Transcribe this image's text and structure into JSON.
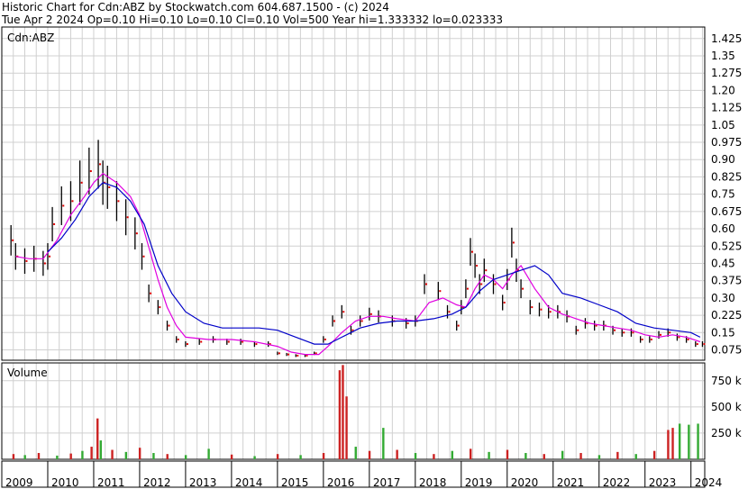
{
  "header": {
    "title_line": "Historic Chart for Cdn:ABZ by Stockwatch.com 604.687.1500 - (c) 2024",
    "stats_line": "Tue Apr  2 2024  Op=0.10  Hi=0.10  Lo=0.10  Cl=0.10  Vol=500  Year hi=1.333332  lo=0.023333"
  },
  "colors": {
    "bar": "#000000",
    "ma_short": "#e000e0",
    "ma_long": "#0000c8",
    "volume_up": "#33aa33",
    "volume_down": "#cc2222",
    "grid": "#d0d0d0",
    "points": "#dd0000"
  },
  "chart_data": [
    {
      "type": "line",
      "panel_label": "Cdn:ABZ",
      "x_ticks": [
        "2009",
        "2010",
        "2011",
        "2012",
        "2013",
        "2014",
        "2015",
        "2016",
        "2017",
        "2018",
        "2019",
        "2020",
        "2021",
        "2022",
        "2023",
        "2024"
      ],
      "y_ticks": [
        "1.425",
        "1.35",
        "1.275",
        "1.20",
        "1.125",
        "1.05",
        "0.975",
        "0.90",
        "0.825",
        "0.75",
        "0.675",
        "0.60",
        "0.525",
        "0.45",
        "0.375",
        "0.30",
        "0.225",
        "0.15",
        "0.075"
      ],
      "ylim": [
        0.03,
        1.475
      ],
      "x_range": [
        2009.0,
        2024.3
      ],
      "series": [
        {
          "key": "price",
          "x": [
            2009.2,
            2009.3,
            2009.5,
            2009.7,
            2009.9,
            2010.0,
            2010.1,
            2010.3,
            2010.5,
            2010.7,
            2010.9,
            2011.1,
            2011.2,
            2011.3,
            2011.5,
            2011.7,
            2011.9,
            2012.05,
            2012.2,
            2012.4,
            2012.6,
            2012.8,
            2013.0,
            2013.3,
            2013.6,
            2013.9,
            2014.2,
            2014.5,
            2014.8,
            2015.0,
            2015.2,
            2015.4,
            2015.6,
            2015.8,
            2016.0,
            2016.2,
            2016.4,
            2016.6,
            2016.8,
            2017.0,
            2017.2,
            2017.5,
            2017.8,
            2018.0,
            2018.2,
            2018.5,
            2018.7,
            2018.9,
            2019.0,
            2019.1,
            2019.2,
            2019.3,
            2019.4,
            2019.5,
            2019.7,
            2019.9,
            2020.0,
            2020.1,
            2020.2,
            2020.3,
            2020.5,
            2020.7,
            2020.9,
            2021.1,
            2021.3,
            2021.5,
            2021.7,
            2021.9,
            2022.1,
            2022.3,
            2022.5,
            2022.7,
            2022.9,
            2023.1,
            2023.3,
            2023.5,
            2023.7,
            2023.9,
            2024.1,
            2024.25
          ],
          "values": [
            0.55,
            0.48,
            0.46,
            0.47,
            0.45,
            0.48,
            0.62,
            0.7,
            0.72,
            0.8,
            0.85,
            0.88,
            0.8,
            0.78,
            0.72,
            0.65,
            0.58,
            0.48,
            0.32,
            0.26,
            0.18,
            0.12,
            0.1,
            0.11,
            0.12,
            0.11,
            0.11,
            0.1,
            0.1,
            0.06,
            0.055,
            0.05,
            0.05,
            0.06,
            0.12,
            0.2,
            0.24,
            0.16,
            0.2,
            0.23,
            0.22,
            0.2,
            0.19,
            0.2,
            0.36,
            0.33,
            0.24,
            0.18,
            0.26,
            0.34,
            0.5,
            0.44,
            0.36,
            0.42,
            0.36,
            0.28,
            0.38,
            0.54,
            0.42,
            0.34,
            0.26,
            0.25,
            0.24,
            0.24,
            0.22,
            0.16,
            0.19,
            0.18,
            0.18,
            0.16,
            0.15,
            0.15,
            0.12,
            0.12,
            0.14,
            0.15,
            0.13,
            0.12,
            0.1,
            0.1
          ]
        },
        {
          "key": "ma_short",
          "x": [
            2009.3,
            2009.6,
            2009.9,
            2010.2,
            2010.5,
            2010.8,
            2011.0,
            2011.2,
            2011.5,
            2011.8,
            2012.0,
            2012.2,
            2012.4,
            2012.6,
            2012.8,
            2013.0,
            2013.5,
            2014.0,
            2014.5,
            2015.0,
            2015.3,
            2015.6,
            2015.9,
            2016.1,
            2016.4,
            2016.7,
            2017.0,
            2017.3,
            2017.6,
            2018.0,
            2018.3,
            2018.6,
            2018.9,
            2019.1,
            2019.3,
            2019.5,
            2019.7,
            2019.9,
            2020.1,
            2020.3,
            2020.6,
            2020.9,
            2021.2,
            2021.5,
            2021.8,
            2022.1,
            2022.4,
            2022.7,
            2023.0,
            2023.3,
            2023.6,
            2023.9,
            2024.2
          ],
          "values": [
            0.48,
            0.47,
            0.47,
            0.55,
            0.66,
            0.74,
            0.8,
            0.84,
            0.8,
            0.74,
            0.66,
            0.52,
            0.38,
            0.26,
            0.18,
            0.13,
            0.12,
            0.12,
            0.11,
            0.09,
            0.065,
            0.055,
            0.055,
            0.09,
            0.15,
            0.2,
            0.22,
            0.22,
            0.21,
            0.2,
            0.28,
            0.3,
            0.27,
            0.26,
            0.34,
            0.4,
            0.38,
            0.34,
            0.4,
            0.44,
            0.34,
            0.26,
            0.23,
            0.21,
            0.19,
            0.18,
            0.17,
            0.16,
            0.14,
            0.13,
            0.14,
            0.13,
            0.11
          ]
        },
        {
          "key": "ma_long",
          "x": [
            2010.0,
            2010.3,
            2010.6,
            2010.9,
            2011.2,
            2011.5,
            2011.8,
            2012.1,
            2012.4,
            2012.7,
            2013.0,
            2013.4,
            2013.8,
            2014.2,
            2014.6,
            2015.0,
            2015.4,
            2015.8,
            2016.1,
            2016.4,
            2016.8,
            2017.2,
            2017.6,
            2018.0,
            2018.4,
            2018.8,
            2019.1,
            2019.4,
            2019.7,
            2020.0,
            2020.3,
            2020.6,
            2020.9,
            2021.2,
            2021.6,
            2022.0,
            2022.4,
            2022.8,
            2023.2,
            2023.6,
            2024.0,
            2024.2
          ],
          "values": [
            0.5,
            0.56,
            0.64,
            0.74,
            0.8,
            0.78,
            0.72,
            0.62,
            0.44,
            0.32,
            0.24,
            0.19,
            0.17,
            0.17,
            0.17,
            0.16,
            0.13,
            0.1,
            0.1,
            0.13,
            0.17,
            0.19,
            0.2,
            0.2,
            0.21,
            0.23,
            0.26,
            0.33,
            0.38,
            0.4,
            0.42,
            0.44,
            0.4,
            0.32,
            0.3,
            0.27,
            0.24,
            0.19,
            0.17,
            0.16,
            0.15,
            0.13
          ]
        }
      ]
    },
    {
      "type": "bar",
      "panel_label": "Volume",
      "y_ticks": [
        "750 k",
        "500 k",
        "250 k"
      ],
      "ylim": [
        0,
        920000
      ],
      "bars": [
        {
          "x": 2009.25,
          "v": 50000,
          "dir": "down"
        },
        {
          "x": 2009.5,
          "v": 40000,
          "dir": "up"
        },
        {
          "x": 2009.8,
          "v": 60000,
          "dir": "down"
        },
        {
          "x": 2010.2,
          "v": 35000,
          "dir": "up"
        },
        {
          "x": 2010.5,
          "v": 55000,
          "dir": "down"
        },
        {
          "x": 2010.75,
          "v": 80000,
          "dir": "up"
        },
        {
          "x": 2010.95,
          "v": 120000,
          "dir": "down"
        },
        {
          "x": 2011.08,
          "v": 390000,
          "dir": "down"
        },
        {
          "x": 2011.15,
          "v": 180000,
          "dir": "up"
        },
        {
          "x": 2011.4,
          "v": 90000,
          "dir": "down"
        },
        {
          "x": 2011.7,
          "v": 70000,
          "dir": "up"
        },
        {
          "x": 2012.0,
          "v": 110000,
          "dir": "down"
        },
        {
          "x": 2012.3,
          "v": 60000,
          "dir": "up"
        },
        {
          "x": 2012.6,
          "v": 50000,
          "dir": "down"
        },
        {
          "x": 2013.0,
          "v": 40000,
          "dir": "up"
        },
        {
          "x": 2013.5,
          "v": 100000,
          "dir": "up"
        },
        {
          "x": 2014.0,
          "v": 45000,
          "dir": "down"
        },
        {
          "x": 2014.5,
          "v": 30000,
          "dir": "up"
        },
        {
          "x": 2015.0,
          "v": 50000,
          "dir": "down"
        },
        {
          "x": 2015.5,
          "v": 40000,
          "dir": "up"
        },
        {
          "x": 2016.0,
          "v": 60000,
          "dir": "down"
        },
        {
          "x": 2016.35,
          "v": 850000,
          "dir": "down"
        },
        {
          "x": 2016.42,
          "v": 900000,
          "dir": "down"
        },
        {
          "x": 2016.5,
          "v": 600000,
          "dir": "down"
        },
        {
          "x": 2016.7,
          "v": 120000,
          "dir": "up"
        },
        {
          "x": 2017.0,
          "v": 80000,
          "dir": "down"
        },
        {
          "x": 2017.3,
          "v": 300000,
          "dir": "up"
        },
        {
          "x": 2017.6,
          "v": 90000,
          "dir": "down"
        },
        {
          "x": 2018.0,
          "v": 60000,
          "dir": "up"
        },
        {
          "x": 2018.4,
          "v": 50000,
          "dir": "down"
        },
        {
          "x": 2018.8,
          "v": 80000,
          "dir": "up"
        },
        {
          "x": 2019.2,
          "v": 100000,
          "dir": "down"
        },
        {
          "x": 2019.6,
          "v": 70000,
          "dir": "up"
        },
        {
          "x": 2020.0,
          "v": 90000,
          "dir": "down"
        },
        {
          "x": 2020.4,
          "v": 60000,
          "dir": "up"
        },
        {
          "x": 2020.8,
          "v": 50000,
          "dir": "down"
        },
        {
          "x": 2021.2,
          "v": 80000,
          "dir": "up"
        },
        {
          "x": 2021.6,
          "v": 60000,
          "dir": "down"
        },
        {
          "x": 2022.0,
          "v": 40000,
          "dir": "up"
        },
        {
          "x": 2022.4,
          "v": 70000,
          "dir": "down"
        },
        {
          "x": 2022.8,
          "v": 50000,
          "dir": "up"
        },
        {
          "x": 2023.2,
          "v": 80000,
          "dir": "down"
        },
        {
          "x": 2023.5,
          "v": 280000,
          "dir": "down"
        },
        {
          "x": 2023.6,
          "v": 300000,
          "dir": "down"
        },
        {
          "x": 2023.75,
          "v": 340000,
          "dir": "up"
        },
        {
          "x": 2023.95,
          "v": 330000,
          "dir": "up"
        },
        {
          "x": 2024.15,
          "v": 340000,
          "dir": "up"
        }
      ]
    }
  ]
}
